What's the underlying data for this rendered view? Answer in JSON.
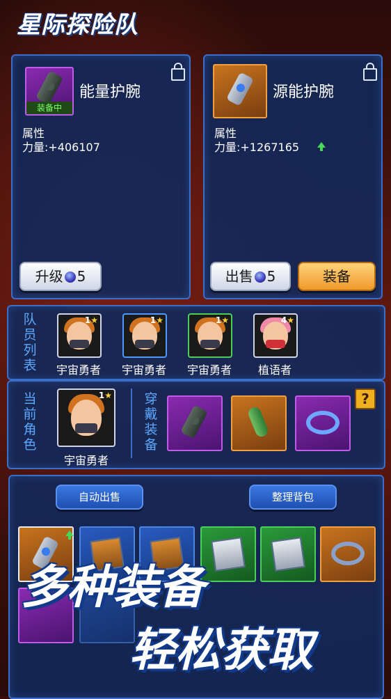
{
  "app": {
    "logo_text": "星际探险队"
  },
  "left_item": {
    "name": "能量护腕",
    "status_badge": "装备中",
    "attr_label": "属性",
    "stat_text": "力量:+406107",
    "button_upgrade": "升级",
    "upgrade_cost": "5"
  },
  "right_item": {
    "name": "源能护腕",
    "attr_label": "属性",
    "stat_text": "力量:+1267165",
    "button_sell": "出售",
    "sell_price": "5",
    "button_equip": "装备"
  },
  "team": {
    "label": "队员列表",
    "members": [
      {
        "name": "宇宙勇者",
        "level": "1"
      },
      {
        "name": "宇宙勇者",
        "level": "1"
      },
      {
        "name": "宇宙勇者",
        "level": "1"
      },
      {
        "name": "植语者",
        "level": "4"
      }
    ]
  },
  "current": {
    "label": "当前角色",
    "character_name": "宇宙勇者",
    "level": "1",
    "wear_label": "穿戴装备",
    "help_symbol": "?"
  },
  "bag": {
    "auto_sell": "自动出售",
    "organize": "整理背包"
  },
  "slogan": {
    "line1": "多种装备",
    "line2": "轻松获取"
  },
  "colors": {
    "accent_blue": "#3a6ec8",
    "gold_button": "#f09a2c",
    "panel": "#12285a"
  }
}
